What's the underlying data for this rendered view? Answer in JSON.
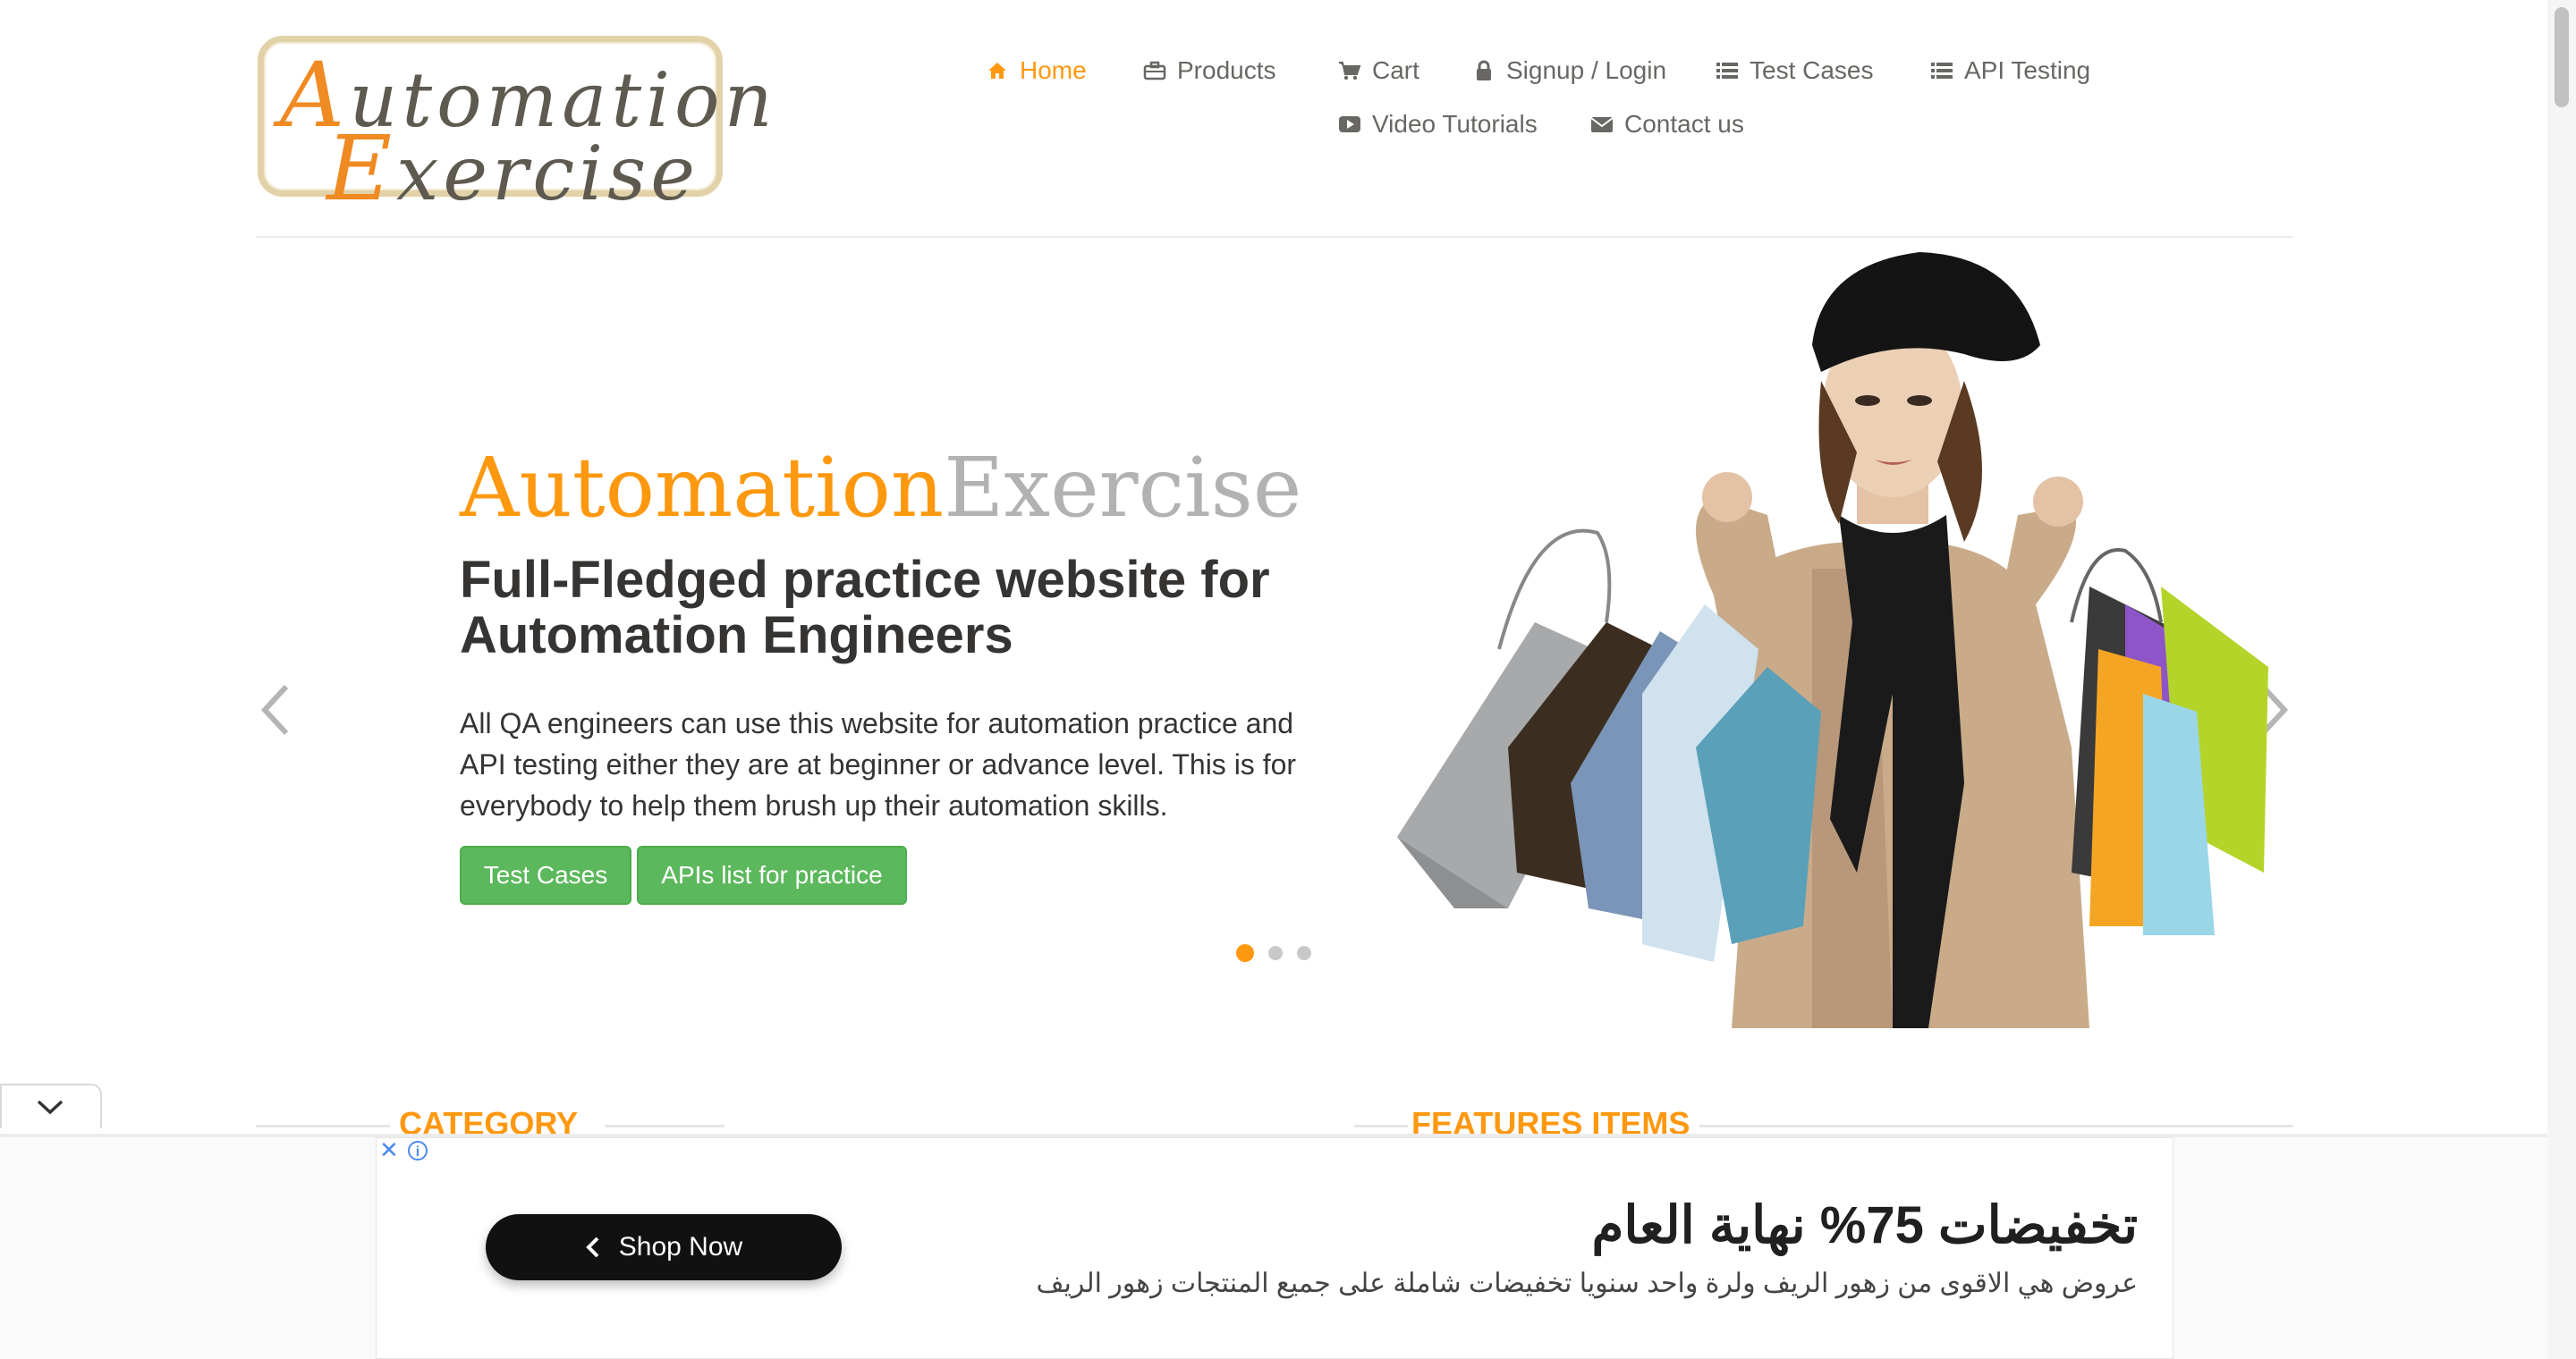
{
  "logo": {
    "line1_cap": "A",
    "line1_rest": "utomation",
    "line2_cap": "E",
    "line2_rest": "xercise",
    "alt": "Automation Exercise"
  },
  "nav": {
    "items": [
      {
        "label": "Home",
        "icon": "home-icon",
        "active": true
      },
      {
        "label": "Products",
        "icon": "briefcase-icon"
      },
      {
        "label": "Cart",
        "icon": "cart-icon"
      },
      {
        "label": "Signup / Login",
        "icon": "lock-icon"
      },
      {
        "label": "Test Cases",
        "icon": "list-icon"
      },
      {
        "label": "API Testing",
        "icon": "list-icon"
      },
      {
        "label": "Video Tutorials",
        "icon": "youtube-play-icon"
      },
      {
        "label": "Contact us",
        "icon": "envelope-icon"
      }
    ]
  },
  "slider": {
    "title_part1": "Automation",
    "title_part2": "Exercise",
    "headline": "Full-Fledged practice website for Automation Engineers",
    "description": "All QA engineers can use this website for automation practice and API testing either they are at beginner or advance level. This is for everybody to help them brush up their automation skills.",
    "btn_testcases": "Test Cases",
    "btn_apis": "APIs list for practice",
    "slide_count": 3,
    "active_slide": 1
  },
  "sections": {
    "category": "CATEGORY",
    "features": "FEATURES ITEMS"
  },
  "ad": {
    "shop_now": "Shop Now",
    "headline": "تخفيضات 75% نهاية العام",
    "sub": "عروض هي الاقوى من زهور الريف ولرة واحد سنويا تخفيضات شاملة على جميع المنتجات زهور الريف"
  },
  "colors": {
    "accent": "#FE980F",
    "button_green": "#5cb85c",
    "text_dark": "#363432",
    "text_grey": "#696763"
  }
}
